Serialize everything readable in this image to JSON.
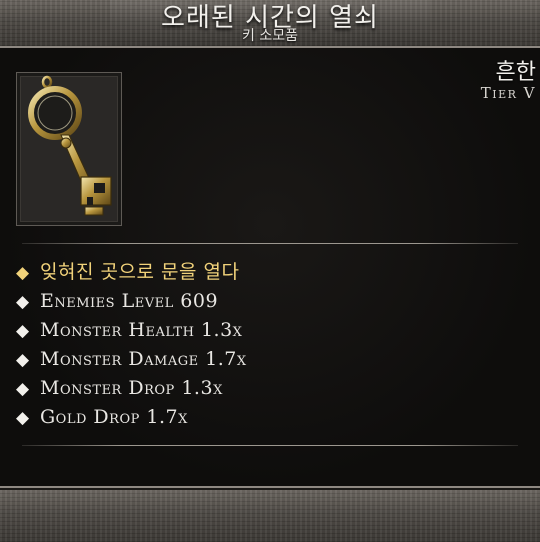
{
  "item": {
    "name": "오래된 시간의 열쇠",
    "category": "키 소모품",
    "rarity": "흔한",
    "tier": "Tier V",
    "icon": "ornate-gold-key-icon"
  },
  "stats": [
    {
      "text": "잊혀진 곳으로 문을 열다",
      "highlight": true,
      "color": "#f1d27a"
    },
    {
      "text": "Enemies Level 609",
      "highlight": false
    },
    {
      "text": "Monster Health 1.3x",
      "highlight": false
    },
    {
      "text": "Monster Damage 1.7x",
      "highlight": false
    },
    {
      "text": "Monster Drop 1.3x",
      "highlight": false
    },
    {
      "text": "Gold Drop 1.7x",
      "highlight": false
    }
  ],
  "bullet": "◆"
}
